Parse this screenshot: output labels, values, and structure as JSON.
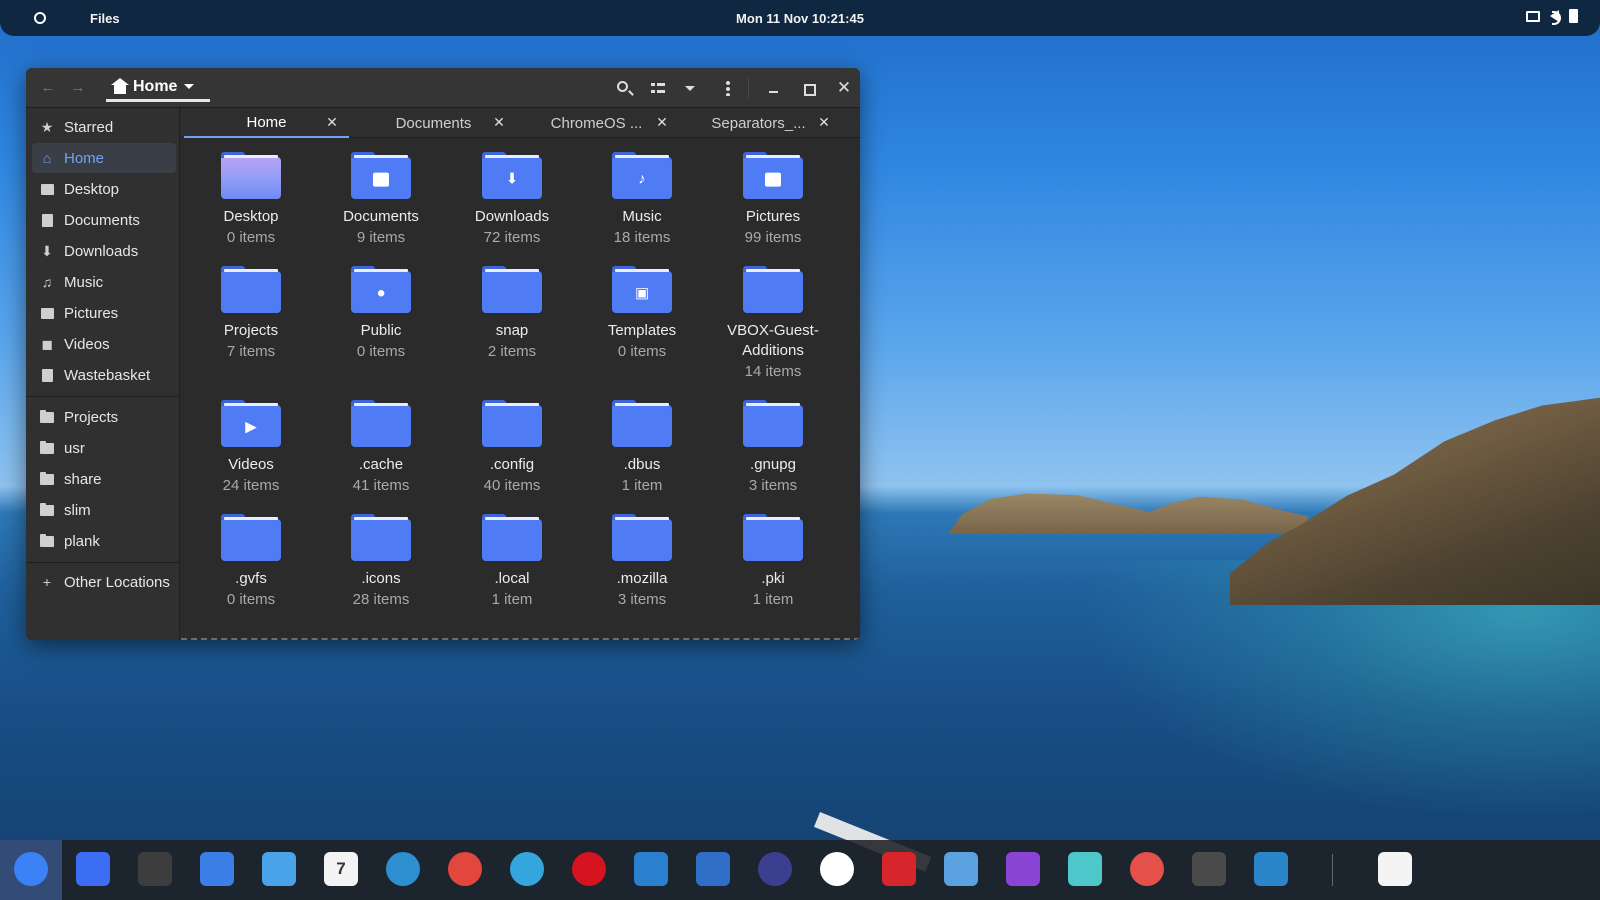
{
  "topbar": {
    "app_name": "Files",
    "clock": "Mon 11 Nov  10:21:45"
  },
  "window": {
    "path_label": "Home",
    "tabs": [
      {
        "label": "Home"
      },
      {
        "label": "Documents"
      },
      {
        "label": "ChromeOS ..."
      },
      {
        "label": "Separators_..."
      }
    ]
  },
  "sidebar": {
    "places": [
      {
        "label": "Starred",
        "icon": "star-icon"
      },
      {
        "label": "Home",
        "icon": "home-icon"
      },
      {
        "label": "Desktop",
        "icon": "desktop-icon"
      },
      {
        "label": "Documents",
        "icon": "document-icon"
      },
      {
        "label": "Downloads",
        "icon": "download-icon"
      },
      {
        "label": "Music",
        "icon": "music-icon"
      },
      {
        "label": "Pictures",
        "icon": "picture-icon"
      },
      {
        "label": "Videos",
        "icon": "video-icon"
      },
      {
        "label": "Wastebasket",
        "icon": "trash-icon"
      }
    ],
    "bookmarks": [
      {
        "label": "Projects"
      },
      {
        "label": "usr"
      },
      {
        "label": "share"
      },
      {
        "label": "slim"
      },
      {
        "label": "plank"
      }
    ],
    "other": "Other Locations"
  },
  "files": [
    {
      "name": "Desktop",
      "count": "0 items",
      "icon": "desktop-folder-icon"
    },
    {
      "name": "Documents",
      "count": "9 items",
      "icon": "documents-folder-icon"
    },
    {
      "name": "Downloads",
      "count": "72 items",
      "icon": "downloads-folder-icon"
    },
    {
      "name": "Music",
      "count": "18 items",
      "icon": "music-folder-icon"
    },
    {
      "name": "Pictures",
      "count": "99 items",
      "icon": "pictures-folder-icon"
    },
    {
      "name": "Projects",
      "count": "7 items",
      "icon": "folder-icon"
    },
    {
      "name": "Public",
      "count": "0 items",
      "icon": "public-folder-icon"
    },
    {
      "name": "snap",
      "count": "2 items",
      "icon": "folder-icon"
    },
    {
      "name": "Templates",
      "count": "0 items",
      "icon": "templates-folder-icon"
    },
    {
      "name": "VBOX-Guest-\nAdditions",
      "count": "14 items",
      "icon": "folder-icon"
    },
    {
      "name": "Videos",
      "count": "24 items",
      "icon": "videos-folder-icon"
    },
    {
      "name": ".cache",
      "count": "41 items",
      "icon": "folder-icon"
    },
    {
      "name": ".config",
      "count": "40 items",
      "icon": "folder-icon"
    },
    {
      "name": ".dbus",
      "count": "1 item",
      "icon": "folder-icon"
    },
    {
      "name": ".gnupg",
      "count": "3 items",
      "icon": "folder-icon"
    },
    {
      "name": ".gvfs",
      "count": "0 items",
      "icon": "folder-icon"
    },
    {
      "name": ".icons",
      "count": "28 items",
      "icon": "folder-icon"
    },
    {
      "name": ".local",
      "count": "1 item",
      "icon": "folder-icon"
    },
    {
      "name": ".mozilla",
      "count": "3 items",
      "icon": "folder-icon"
    },
    {
      "name": ".pki",
      "count": "1 item",
      "icon": "folder-icon"
    }
  ],
  "dock": {
    "apps": [
      {
        "icon": "finder-icon",
        "color": "#3b82f6"
      },
      {
        "icon": "store-icon",
        "color": "#3b6ef5"
      },
      {
        "icon": "terminal-split-icon",
        "color": "#3d3d3d"
      },
      {
        "icon": "contacts-icon",
        "color": "#3a7ee6"
      },
      {
        "icon": "mail-icon",
        "color": "#4aa3e8"
      },
      {
        "icon": "calendar-icon",
        "color": "#f3f3f3",
        "text": "7"
      },
      {
        "icon": "tasks-icon",
        "color": "#2d8fd0"
      },
      {
        "icon": "downloader-icon",
        "color": "#e2473d"
      },
      {
        "icon": "telegram-icon",
        "color": "#34a6de"
      },
      {
        "icon": "opera-icon",
        "color": "#d5141f"
      },
      {
        "icon": "notes-icon",
        "color": "#2a7fcf"
      },
      {
        "icon": "disk-icon",
        "color": "#2f6fc8"
      },
      {
        "icon": "waveform-icon",
        "color": "#3c3f8f"
      },
      {
        "icon": "coral-icon",
        "color": "#ffffff"
      },
      {
        "icon": "pdf-icon",
        "color": "#d6262b"
      },
      {
        "icon": "image-viewer-icon",
        "color": "#5aa2e0"
      },
      {
        "icon": "crop-icon",
        "color": "#8a45d4"
      },
      {
        "icon": "video-editor-icon",
        "color": "#4dc7c9"
      },
      {
        "icon": "music-player-icon",
        "color": "#e6504a"
      },
      {
        "icon": "terminal-icon",
        "color": "#4a4a4a"
      },
      {
        "icon": "settings-icon",
        "color": "#2b86c9"
      },
      {
        "icon": "trash-bin-icon",
        "color": "#f4f4f4"
      }
    ]
  }
}
